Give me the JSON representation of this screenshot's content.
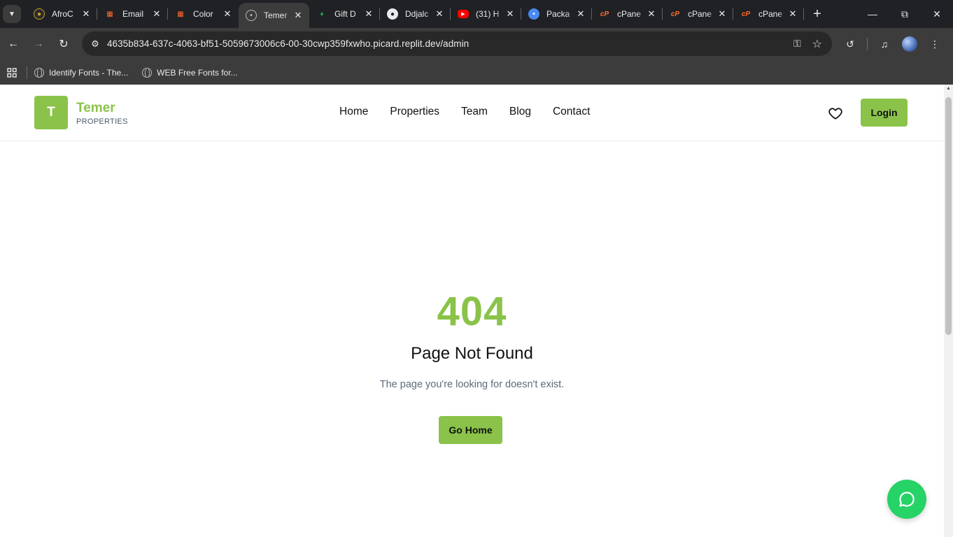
{
  "browser": {
    "tabs": [
      {
        "title": "AfroC",
        "icon": "afro-icon",
        "active": false
      },
      {
        "title": "Email",
        "icon": "cpanel-cube-icon",
        "active": false
      },
      {
        "title": "Color",
        "icon": "cpanel-cube-icon",
        "active": false
      },
      {
        "title": "Temer",
        "icon": "globe-icon",
        "active": true
      },
      {
        "title": "Gift D",
        "icon": "leaf-icon",
        "active": false
      },
      {
        "title": "Ddjalc",
        "icon": "github-icon",
        "active": false
      },
      {
        "title": "(31) H",
        "icon": "youtube-icon",
        "active": false
      },
      {
        "title": "Packa",
        "icon": "globe-blue-icon",
        "active": false
      },
      {
        "title": "cPane",
        "icon": "cpanel-icon",
        "active": false
      },
      {
        "title": "cPane",
        "icon": "cpanel-icon",
        "active": false
      },
      {
        "title": "cPane",
        "icon": "cpanel-icon",
        "active": false
      }
    ],
    "url": "4635b834-637c-4063-bf51-5059673006c6-00-30cwp359fxwho.picard.replit.dev/admin",
    "bookmarks": [
      {
        "label": "Identify Fonts - The..."
      },
      {
        "label": "WEB Free Fonts for..."
      }
    ]
  },
  "site": {
    "logo_letter": "T",
    "brand_name": "Temer",
    "brand_sub": "PROPERTIES",
    "nav": [
      "Home",
      "Properties",
      "Team",
      "Blog",
      "Contact"
    ],
    "login_label": "Login"
  },
  "not_found": {
    "code": "404",
    "title": "Page Not Found",
    "description": "The page you're looking for doesn't exist.",
    "button": "Go Home"
  },
  "colors": {
    "accent": "#8bc34a",
    "whatsapp": "#25d366",
    "chrome_dark": "#202124",
    "chrome_toolbar": "#3c3c3c"
  }
}
